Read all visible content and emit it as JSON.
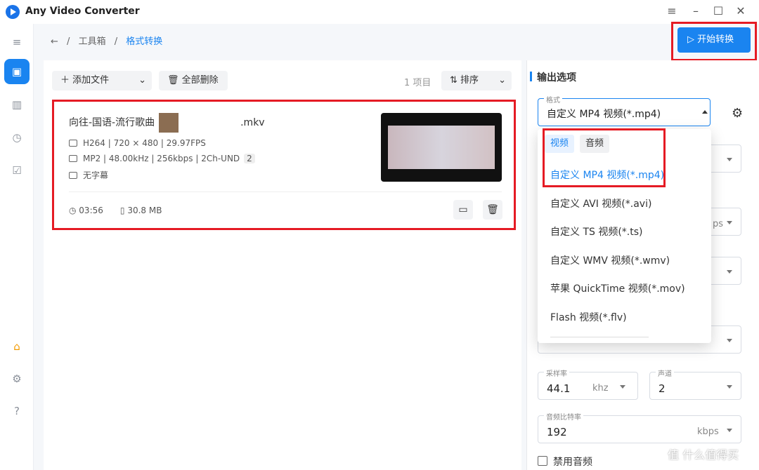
{
  "app": {
    "title": "Any Video Converter",
    "window_controls": [
      "≡",
      "–",
      "☐",
      "✕"
    ]
  },
  "breadcrumb": {
    "back_icon": "back-arrow-icon",
    "items": [
      "工具箱",
      "格式转换"
    ]
  },
  "actions": {
    "start_convert": "开始转换"
  },
  "toolbar": {
    "add_files": "添加文件",
    "delete_all": "全部删除",
    "item_count": "1 项目",
    "sort": "排序"
  },
  "file": {
    "name_prefix": "向往-国语-流行歌曲",
    "extension": ".mkv",
    "video_info": "H264 | 720 × 480 | 29.97FPS",
    "audio_info": "MP2 | 48.00kHz | 256kbps | 2Ch-UND",
    "audio_tracks": "2",
    "subtitle": "无字幕",
    "duration": "03:56",
    "size": "30.8 MB"
  },
  "output_panel": {
    "title": "输出选项",
    "format": {
      "label": "格式",
      "value": "自定义 MP4 视频(*.mp4)"
    },
    "sample_rate": {
      "label": "采样率",
      "value": "44.1",
      "unit": "khz"
    },
    "channels": {
      "label": "声道",
      "value": "2"
    },
    "audio_bitrate": {
      "label": "音频比特率",
      "value": "192",
      "unit": "kbps"
    },
    "disable_audio": "禁用音频",
    "hidden_unit": "ps"
  },
  "dropdown": {
    "tabs": [
      "视频",
      "音频"
    ],
    "items": [
      "自定义 MP4 视频(*.mp4)",
      "自定义 AVI 视频(*.avi)",
      "自定义 TS 视频(*.ts)",
      "自定义 WMV 视频(*.wmv)",
      "苹果 QuickTime 视频(*.mov)",
      "Flash 视频(*.flv)"
    ]
  },
  "watermark": "值 什么值得买",
  "colors": {
    "accent": "#1a84f0",
    "highlight": "#e51b24",
    "sidebar_active": "#1a84f0"
  }
}
